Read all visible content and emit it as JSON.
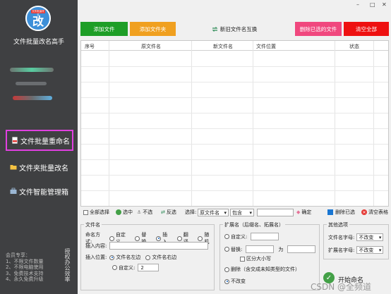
{
  "sidebar": {
    "logo_badge": "文件批量改名",
    "logo_glyph": "改",
    "app_title": "文件批量改名高手",
    "nav": [
      {
        "label": "文件批量重命名",
        "icon": "document-icon",
        "active": true
      },
      {
        "label": "文件夹批量改名",
        "icon": "folder-icon",
        "active": false
      },
      {
        "label": "文件智能管理箱",
        "icon": "toolbox-icon",
        "active": false
      }
    ],
    "footer_title": "会员专享：",
    "footer_lines": [
      "1、不限文件数量",
      "2、不限电脑使用",
      "3、免费技术支持",
      "4、永久免费升级"
    ],
    "vertical_text": "授权办公效率"
  },
  "window": {
    "min": "–",
    "max": "□",
    "close": "✕"
  },
  "toolbar": {
    "add_file": "添加文件",
    "add_folder": "添加文件夹",
    "create_interop": "新旧文件名互换",
    "delete_selected_files": "删除已选的文件",
    "clear_all": "清空全部"
  },
  "colors": {
    "green": "#1e9e27",
    "orange": "#f0a020",
    "pink": "#f0487e",
    "red": "#ee1111",
    "sidebar": "#3f4042"
  },
  "table": {
    "columns": [
      "序号",
      "原文件名",
      "新文件名",
      "文件位置",
      "状态"
    ]
  },
  "action_bar": {
    "select_all": "全部选择",
    "select": "选中",
    "deselect": "不选",
    "invert": "反选",
    "choose_label": "选择:",
    "choose_value": "原文件名",
    "contains_value": "包含",
    "confirm": "确定",
    "delete_selected": "删除已选",
    "clear_table": "清空表格"
  },
  "filename_group": {
    "title": "文件名",
    "mode_label": "命名方式:",
    "modes": [
      {
        "label": "自定义",
        "on": false
      },
      {
        "label": "替换",
        "on": false
      },
      {
        "label": "插入",
        "on": true
      },
      {
        "label": "翻译",
        "on": false
      },
      {
        "label": "随机",
        "on": false
      }
    ],
    "insert_content_label": "插入内容:",
    "insert_pos_label": "插入位置:",
    "pos_left": "文件名左边",
    "pos_right": "文件名右边",
    "custom_label": "自定义:",
    "custom_value": "2"
  },
  "ext_group": {
    "title": "扩展名（后缀名、拓展名）",
    "custom_label": "自定义:",
    "replace_label": "替换:",
    "to_label": "为",
    "case_sensitive": "区分大小写",
    "delete_label": "删除（含交成未知类型的文件）",
    "unchanged": "不改变"
  },
  "other_group": {
    "title": "其他选项",
    "case_label": "文件名字母:",
    "case_value": "不改变",
    "ext_case_label": "扩展名字母:",
    "ext_case_value": "不改变"
  },
  "start": {
    "label": "开始命名"
  },
  "watermark": "CSDN @全频道"
}
